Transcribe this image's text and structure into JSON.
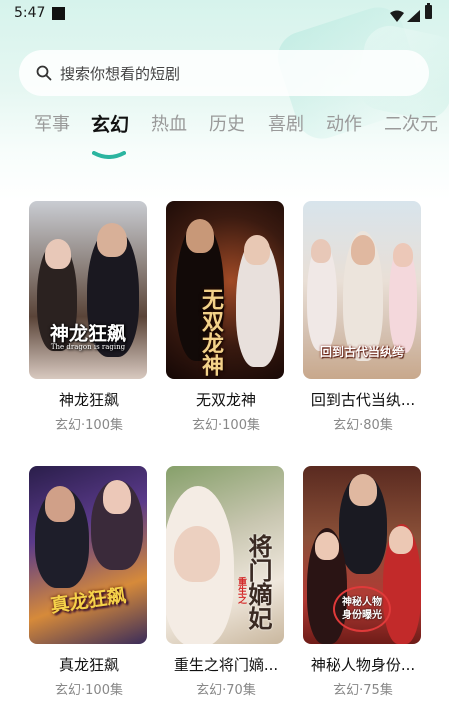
{
  "status_bar": {
    "time": "5:47"
  },
  "search": {
    "placeholder": "搜索你想看的短剧"
  },
  "tabs": [
    {
      "label": "军事",
      "active": false
    },
    {
      "label": "玄幻",
      "active": true
    },
    {
      "label": "热血",
      "active": false
    },
    {
      "label": "历史",
      "active": false
    },
    {
      "label": "喜剧",
      "active": false
    },
    {
      "label": "动作",
      "active": false
    },
    {
      "label": "二次元",
      "active": false
    }
  ],
  "dramas": [
    {
      "title": "神龙狂飙",
      "subtitle": "玄幻·100集",
      "poster_text": "神龙狂飙",
      "poster_tagline": "The dragon is raging"
    },
    {
      "title": "无双龙神",
      "subtitle": "玄幻·100集",
      "poster_text": "无双龙神"
    },
    {
      "title": "回到古代当纨...",
      "subtitle": "玄幻·80集",
      "poster_text": "回到古代当纨绔"
    },
    {
      "title": "真龙狂飙",
      "subtitle": "玄幻·100集",
      "poster_text": "真龙狂飙"
    },
    {
      "title": "重生之将门嫡...",
      "subtitle": "玄幻·70集",
      "poster_text": "将门嫡妃",
      "poster_tag": "重生之"
    },
    {
      "title": "神秘人物身份...",
      "subtitle": "玄幻·75集",
      "poster_text": "神秘人物身份曝光"
    }
  ],
  "colors": {
    "accent": "#2bb5a0",
    "header_bg": "#d6f3ec",
    "text_primary": "#111111",
    "text_secondary": "#888888",
    "tab_inactive": "#9a9a9a"
  }
}
